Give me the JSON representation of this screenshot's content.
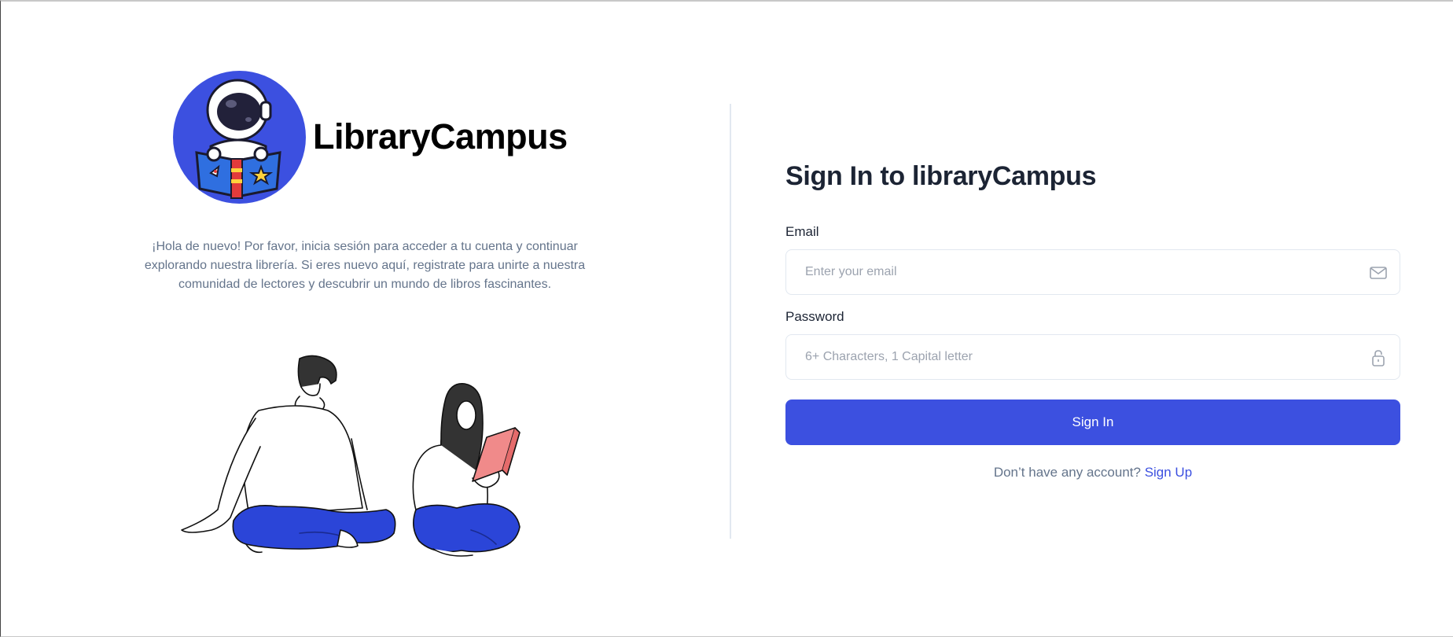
{
  "brand": {
    "name": "LibraryCampus",
    "logo_icon": "astronaut-reading-book-icon"
  },
  "intro": {
    "text": "¡Hola de nuevo! Por favor, inicia sesión para acceder a tu cuenta y continuar explorando nuestra librería. Si eres nuevo aquí, registrate para unirte a nuestra comunidad de lectores y descubrir un mundo de libros fascinantes."
  },
  "illustration": {
    "icon": "people-reading-illustration"
  },
  "form": {
    "title": "Sign In to libraryCampus",
    "email": {
      "label": "Email",
      "placeholder": "Enter your email",
      "value": "",
      "icon": "envelope-icon"
    },
    "password": {
      "label": "Password",
      "placeholder": "6+ Characters, 1 Capital letter",
      "value": "",
      "icon": "lock-icon"
    },
    "submit_label": "Sign In",
    "signup_prompt": "Don’t have any account?",
    "signup_link": "Sign Up"
  },
  "colors": {
    "primary": "#3c50e0",
    "text_dark": "#1c2434",
    "text_muted": "#64748b",
    "border": "#e2e8f0"
  }
}
